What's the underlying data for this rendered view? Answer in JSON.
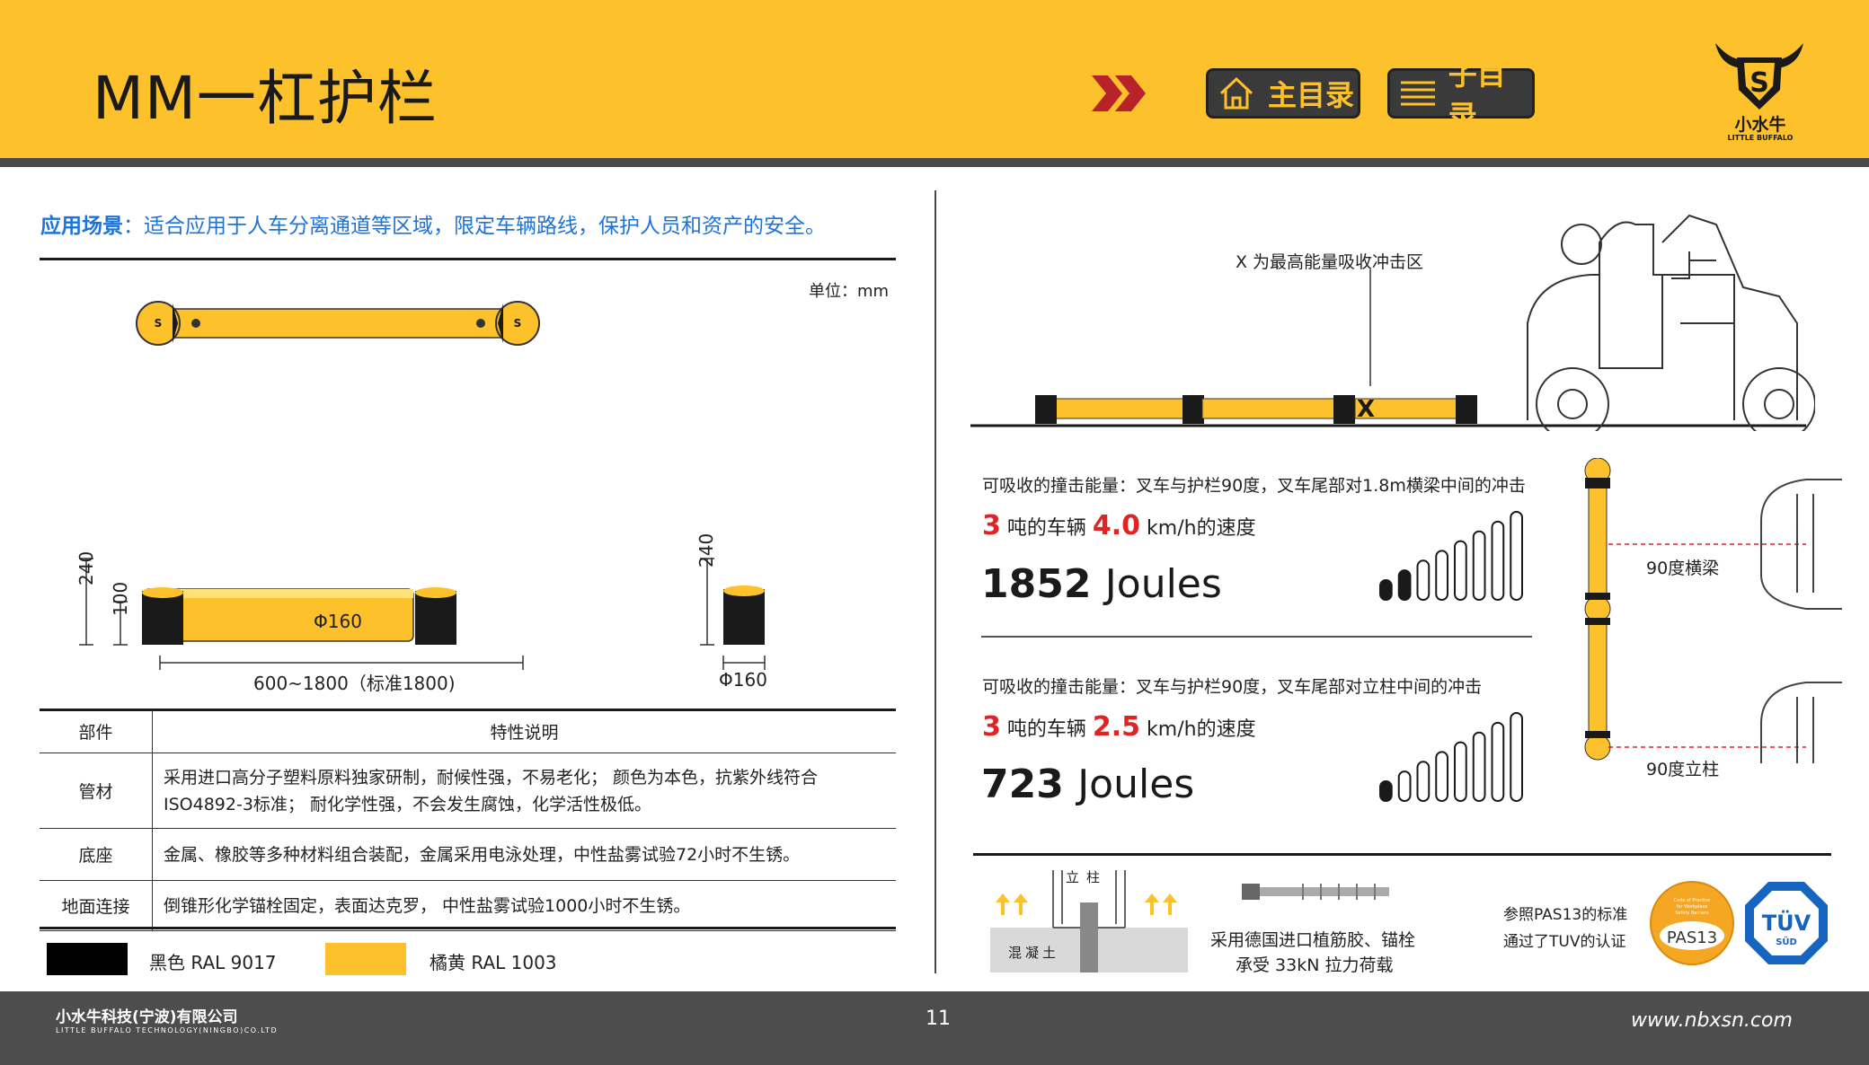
{
  "header": {
    "title": "MM一杠护栏",
    "nav": {
      "main_menu": "主目录",
      "sub_menu": "子目录"
    },
    "logo": {
      "name": "小水牛",
      "sub": "LITTLE BUFFALO",
      "letter": "S"
    }
  },
  "scene": {
    "label": "应用场景",
    "text": "：适合应用于人车分离通道等区域，限定车辆路线，保护人员和资产的安全。"
  },
  "drawing": {
    "unit": "单位：mm",
    "dim_240": "240",
    "dim_100": "100",
    "dim_phi160_bar": "Φ160",
    "dim_phi160_post": "Φ160",
    "dim_length": "600~1800（标准1800)",
    "dim_240_side": "240",
    "dim_phi160_side": "Φ160"
  },
  "table": {
    "headers": [
      "部件",
      "特性说明"
    ],
    "rows": [
      {
        "part": "管材",
        "lines": [
          "采用进口高分子塑料原料独家研制，耐候性强，不易老化； 颜色为本色，抗紫外线符合",
          "ISO4892-3标准； 耐化学性强，不会发生腐蚀，化学活性极低。"
        ]
      },
      {
        "part": "底座",
        "lines": [
          "金属、橡胶等多种材料组合装配，金属采用电泳处理，中性盐雾试验72小时不生锈。"
        ]
      },
      {
        "part": "地面连接",
        "lines": [
          "倒锥形化学锚栓固定，表面达克罗， 中性盐雾试验1000小时不生锈。"
        ]
      }
    ]
  },
  "colors": {
    "black": {
      "label": "黑色  RAL 9017",
      "hex": "#000000"
    },
    "yellow": {
      "label": "橘黄  RAL 1003",
      "hex": "#fdc12c"
    },
    "accent_red": "#e02424"
  },
  "impact_zone": {
    "label": "X 为最高能量吸收冲击区",
    "mark": "X"
  },
  "impacts": [
    {
      "desc": "可吸收的撞击能量：叉车与护栏90度，叉车尾部对1.8m横梁中间的冲击",
      "tons": "3",
      "tons_text": "吨的车辆",
      "speed": "4.0",
      "speed_text": "km/h的速度",
      "joules": "1852",
      "joules_unit": "Joules",
      "level": 2,
      "max_level": 8
    },
    {
      "desc": "可吸收的撞击能量：叉车与护栏90度，叉车尾部对立柱中间的冲击",
      "tons": "3",
      "tons_text": "吨的车辆",
      "speed": "2.5",
      "speed_text": "km/h的速度",
      "joules": "723",
      "joules_unit": "Joules",
      "level": 1,
      "max_level": 8
    }
  ],
  "side_labels": {
    "beam": "90度横梁",
    "post": "90度立柱"
  },
  "anchor": {
    "post_label": "立柱",
    "concrete_label": "混凝土",
    "text1": "采用德国进口植筋胶、锚栓",
    "text2": "承受 33kN 拉力荷载"
  },
  "certs": {
    "text1": "参照PAS13的标准",
    "text2": "通过了TUV的认证",
    "pas13": "PAS13",
    "pas13_small": "Code of Practice for Workplace Safety Barriers",
    "tuv": "TÜV",
    "tuv_sub": "SÜD"
  },
  "footer": {
    "company": "小水牛科技(宁波)有限公司",
    "company_en": "LITTLE BUFFALO TECHNOLOGY(NINGBO)CO.LTD",
    "page": "11",
    "url": "www.nbxsn.com"
  }
}
